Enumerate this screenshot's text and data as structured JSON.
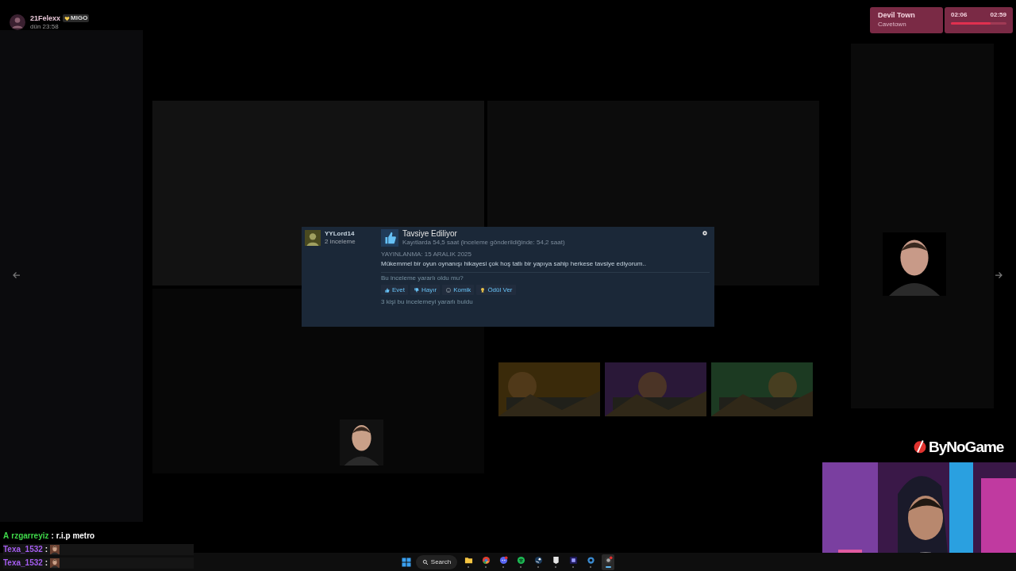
{
  "streamer": {
    "name": "21Felexx",
    "badge": "MIGO",
    "time": "dün 23:58"
  },
  "now_playing": {
    "title": "Devil Town",
    "artist": "Cavetown",
    "elapsed": "02:06",
    "total": "02:59",
    "level": 0.72
  },
  "review": {
    "author": "YYLord14",
    "author_reviews": "2 inceleme",
    "verdict": "Tavsiye Ediliyor",
    "playtime": "Kayıtlarda 54,5 saat (inceleme gönderildiğinde: 54,2 saat)",
    "posted": "YAYINLANMA: 15 ARALIK 2025",
    "text": "Mükemmel bir oyun oynanışı hikayesi çok hoş tatlı bir yapıya sahip herkese tavsiye ediyorum..",
    "helpful_prompt": "Bu inceleme yararlı oldu mu?",
    "actions": [
      {
        "kind": "yes",
        "label": "Evet"
      },
      {
        "kind": "no",
        "label": "Hayır"
      },
      {
        "kind": "funny",
        "label": "Komik"
      },
      {
        "kind": "award",
        "label": "Ödül Ver"
      }
    ],
    "helpful_count": "3 kişi bu incelemeyi yararlı buldu"
  },
  "chat": [
    {
      "kind": "text",
      "prefix": "A",
      "user": "rzgarreyiz",
      "color": "#3fd84a",
      "separator": ":",
      "message": "r.i.p metro"
    },
    {
      "kind": "emote",
      "user": "Texa_1532",
      "color": "#a55df0",
      "separator": ":"
    },
    {
      "kind": "emote",
      "user": "Texa_1532",
      "color": "#a55df0",
      "separator": ":"
    }
  ],
  "brand": "ByNoGame",
  "taskbar": {
    "search": "Search",
    "apps": [
      {
        "kind": "folder",
        "active": false
      },
      {
        "kind": "chrome",
        "active": false
      },
      {
        "kind": "discord",
        "active": false
      },
      {
        "kind": "spotify",
        "active": false
      },
      {
        "kind": "steam",
        "active": false
      },
      {
        "kind": "epic",
        "active": false
      },
      {
        "kind": "premiere",
        "active": false
      },
      {
        "kind": "settings",
        "active": false
      },
      {
        "kind": "obs",
        "active": true
      }
    ]
  }
}
